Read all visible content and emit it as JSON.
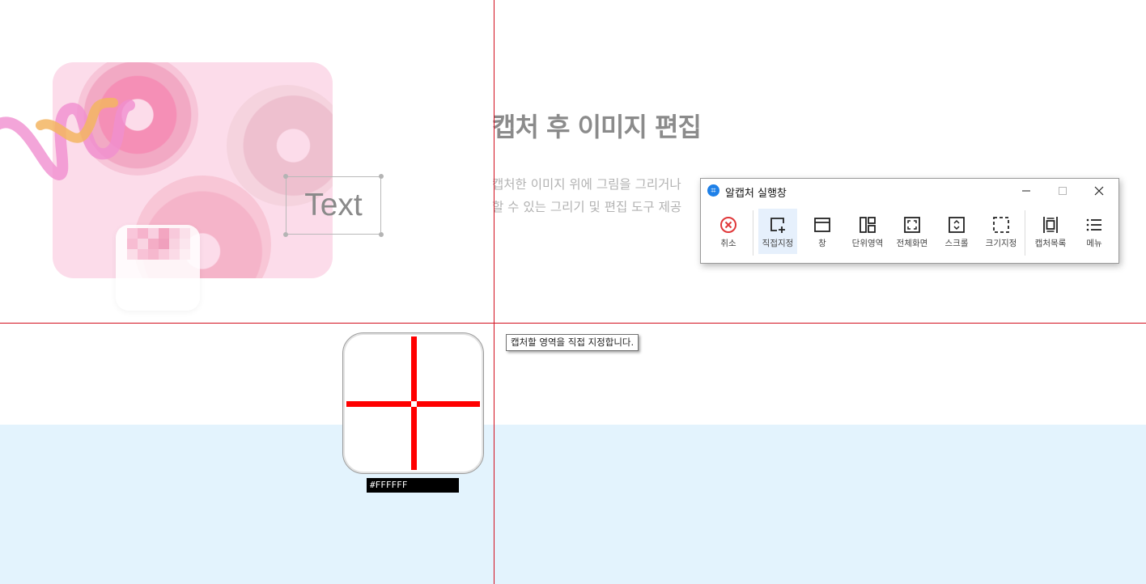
{
  "page": {
    "title": "캡처 후 이미지 편집",
    "description_lines": [
      "캡처한 이미지 위에 그림을 그리거나",
      "할 수 있는 그리기 및 편집 도구 제공"
    ],
    "text_box_label": "Text"
  },
  "capture_window": {
    "title": "알캡처 실행창",
    "tools": [
      {
        "label": "취소",
        "icon": "cancel-icon"
      },
      {
        "label": "직접지정",
        "icon": "direct-select-icon",
        "active": true
      },
      {
        "label": "창",
        "icon": "window-icon"
      },
      {
        "label": "단위영역",
        "icon": "unit-area-icon"
      },
      {
        "label": "전체화면",
        "icon": "fullscreen-icon"
      },
      {
        "label": "스크롤",
        "icon": "scroll-icon"
      },
      {
        "label": "크기지정",
        "icon": "size-select-icon"
      },
      {
        "label": "캡처목록",
        "icon": "capture-list-icon"
      },
      {
        "label": "메뉴",
        "icon": "menu-icon"
      }
    ]
  },
  "tooltip": "캡처할 영역을 직접 지정합니다.",
  "magnifier": {
    "color_hex": "#FFFFFF"
  },
  "colors": {
    "crosshair": "#d20f1f",
    "accent_blue": "#1e80e8",
    "cancel_red": "#e0383a",
    "bottom_band": "#e3f3fd"
  }
}
